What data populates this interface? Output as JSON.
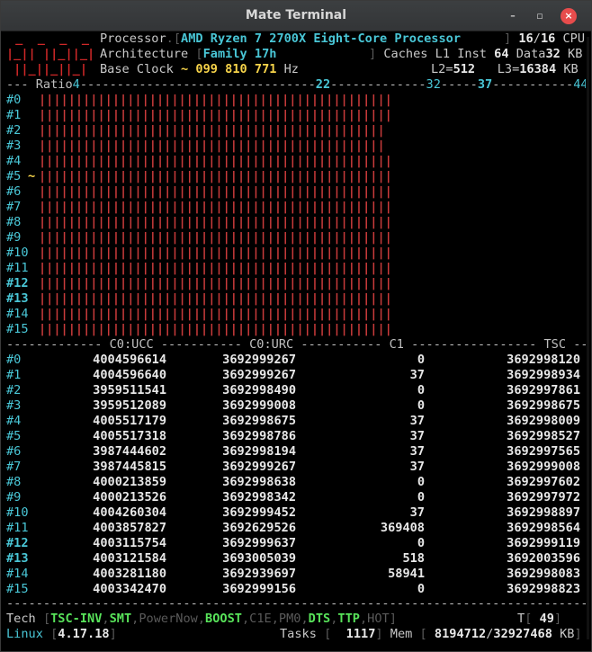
{
  "window": {
    "title": "Mate Terminal",
    "min_glyph": "–",
    "max_glyph": "▫",
    "close_glyph": "×"
  },
  "header": {
    "processor_label": "Processor",
    "processor_value": "AMD Ryzen 7 2700X Eight-Core Processor",
    "cpu_online": "16",
    "cpu_total": "16",
    "cpu_word": "CPU",
    "arch_label": "Architecture",
    "arch_value": "Family 17h",
    "caches_label": "Caches L1 Inst",
    "l1_inst": "64",
    "data_label": "Data",
    "l1_data": "32",
    "kb": "KB",
    "base_label": "Base Clock",
    "base_tilde": "~",
    "base_value": "099 810 771",
    "hz": "Hz",
    "l2_label": "L2",
    "l2_value": "512",
    "l3_label": "L3",
    "l3_value": "16384",
    "logo_lines": [
      " _  _  _  _",
      "|_|| ||_||_|",
      " ||_||_||_|"
    ]
  },
  "ratio": {
    "label": "Ratio",
    "marks": [
      "4",
      "22",
      "32",
      "37",
      "44"
    ],
    "cores": [
      "#0",
      "#1",
      "#2",
      "#3",
      "#4",
      "#5",
      "#6",
      "#7",
      "#8",
      "#9",
      "#10",
      "#11",
      "#12",
      "#13",
      "#14",
      "#15"
    ],
    "bright_cores": [
      "#12",
      "#13"
    ],
    "current_marker_row": 5,
    "current_marker": "~",
    "bar_lengths": [
      37,
      37,
      36,
      36,
      37,
      37,
      37,
      37,
      37,
      37,
      37,
      37,
      37,
      37,
      37,
      37
    ],
    "bar_full": 37
  },
  "counters": {
    "headers": [
      "C0:UCC",
      "C0:URC",
      "C1",
      "TSC"
    ],
    "rows": [
      [
        "#0",
        "4004596614",
        "3692999267",
        "0",
        "3692998120"
      ],
      [
        "#1",
        "4004596640",
        "3692999267",
        "37",
        "3692998934"
      ],
      [
        "#2",
        "3959511541",
        "3692998490",
        "0",
        "3692997861"
      ],
      [
        "#3",
        "3959512089",
        "3692999008",
        "0",
        "3692998675"
      ],
      [
        "#4",
        "4005517179",
        "3692998675",
        "37",
        "3692998009"
      ],
      [
        "#5",
        "4005517318",
        "3692998786",
        "37",
        "3692998527"
      ],
      [
        "#6",
        "3987444602",
        "3692998194",
        "37",
        "3692997565"
      ],
      [
        "#7",
        "3987445815",
        "3692999267",
        "37",
        "3692999008"
      ],
      [
        "#8",
        "4000213859",
        "3692998638",
        "0",
        "3692997602"
      ],
      [
        "#9",
        "4000213526",
        "3692998342",
        "0",
        "3692997972"
      ],
      [
        "#10",
        "4004260304",
        "3692999452",
        "37",
        "3692998897"
      ],
      [
        "#11",
        "4003857827",
        "3692629526",
        "369408",
        "3692998564"
      ],
      [
        "#12",
        "4003115754",
        "3692999637",
        "0",
        "3692999119"
      ],
      [
        "#13",
        "4003121584",
        "3693005039",
        "518",
        "3692003596"
      ],
      [
        "#14",
        "4003281180",
        "3692939697",
        "58941",
        "3692998083"
      ],
      [
        "#15",
        "4003342470",
        "3692999156",
        "0",
        "3692998823"
      ]
    ]
  },
  "footer": {
    "tech_label": "Tech",
    "tech_items": [
      {
        "label": "TSC-INV",
        "on": true
      },
      {
        "label": "SMT",
        "on": true
      },
      {
        "label": "PowerNow",
        "on": false
      },
      {
        "label": "BOOST",
        "on": true
      },
      {
        "label": "C1E",
        "on": false
      },
      {
        "label": "PM0",
        "on": false
      },
      {
        "label": "DTS",
        "on": true
      },
      {
        "label": "TTP",
        "on": true
      },
      {
        "label": "HOT",
        "on": false
      }
    ],
    "temp_label": "T",
    "temp_value": "49",
    "os_label": "Linux",
    "kernel": "4.17.18",
    "tasks_label": "Tasks",
    "tasks_value": "1117",
    "mem_label": "Mem",
    "mem_used": "8194712",
    "mem_total": "32927468",
    "mem_unit": "KB"
  }
}
